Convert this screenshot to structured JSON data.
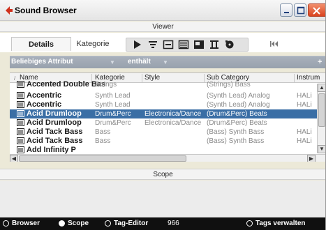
{
  "window": {
    "title": "Sound Browser",
    "icon": "back-arrow-icon",
    "controls": [
      "minimize-icon",
      "maximize-icon",
      "close-icon"
    ]
  },
  "viewer": {
    "label": "Viewer"
  },
  "tabs": [
    {
      "label": "Details",
      "active": true
    },
    {
      "label": "Kategorie",
      "active": false
    }
  ],
  "toolbar": {
    "icons": [
      "play-icon",
      "filter-icon",
      "list-view-icon",
      "details-view-icon",
      "window-icon",
      "tile-view-icon",
      "disc-icon"
    ],
    "extra_icon": "skip-to-start-icon"
  },
  "filter": {
    "attribute": "Beliebiges Attribut",
    "operator": "enthält",
    "value": "",
    "add": "+"
  },
  "table": {
    "columns": [
      "Name",
      "Kategorie",
      "Style",
      "Sub Category",
      "Instrum"
    ],
    "rows": [
      {
        "name": "Accented Double Bas",
        "category": "Strings",
        "style": "",
        "sub": "(Strings) Bass",
        "inst": "",
        "selected": false
      },
      {
        "name": "Accentric",
        "category": "Synth Lead",
        "style": "",
        "sub": "(Synth Lead) Analog",
        "inst": "HALi",
        "selected": false
      },
      {
        "name": "Accentric",
        "category": "Synth Lead",
        "style": "",
        "sub": "(Synth Lead) Analog",
        "inst": "HALi",
        "selected": false
      },
      {
        "name": "Acid Drumloop",
        "category": "Drum&Perc",
        "style": "Electronica/Dance",
        "sub": "(Drum&Perc) Beats",
        "inst": "",
        "selected": true
      },
      {
        "name": "Acid Drumloop",
        "category": "Drum&Perc",
        "style": "Electronica/Dance",
        "sub": "(Drum&Perc) Beats",
        "inst": "",
        "selected": false
      },
      {
        "name": "Acid Tack Bass",
        "category": "Bass",
        "style": "",
        "sub": "(Bass) Synth Bass",
        "inst": "HALi",
        "selected": false
      },
      {
        "name": "Acid Tack Bass",
        "category": "Bass",
        "style": "",
        "sub": "(Bass) Synth Bass",
        "inst": "HALi",
        "selected": false
      },
      {
        "name": "Add Infinity P",
        "category": "",
        "style": "",
        "sub": "",
        "inst": "",
        "selected": false
      }
    ]
  },
  "scope": {
    "label": "Scope"
  },
  "statusbar": {
    "browser": "Browser",
    "scope": "Scope",
    "tag_editor": "Tag-Editor",
    "count": "966",
    "tags_manage": "Tags verwalten"
  },
  "colors": {
    "selection": "#3a6ea5",
    "filter_bar": "#98a1ad",
    "status_bar": "#101010",
    "close_button": "#d9431f",
    "accent_red": "#d0301c"
  }
}
